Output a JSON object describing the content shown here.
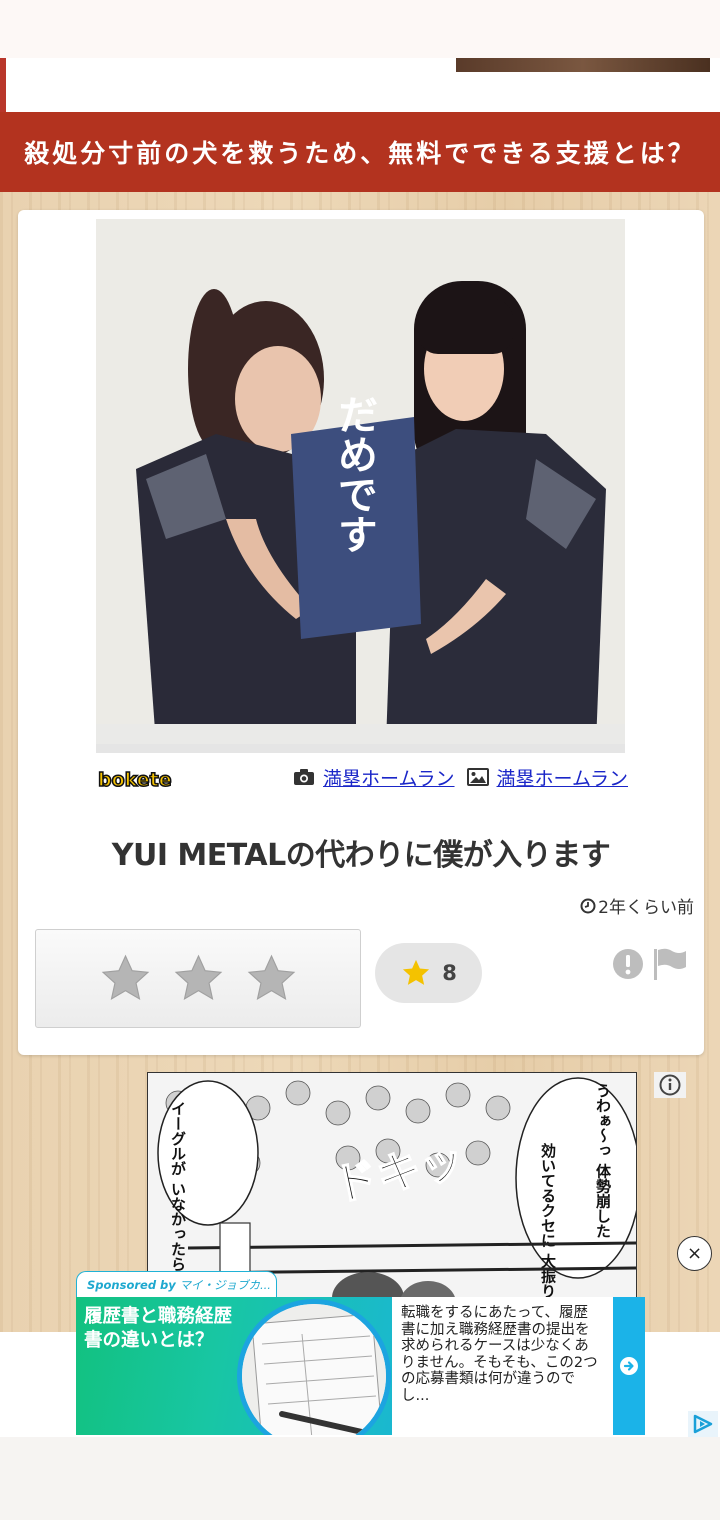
{
  "top_banner": {
    "headline": "殺処分寸前の犬を救うため、無料でできる支援とは？"
  },
  "post": {
    "sign_text": "だめです",
    "logo": "bokete",
    "photo_credit": "満塁ホームラン",
    "image_credit": "満塁ホームラン",
    "caption": "YUI METALの代わりに僕が入ります",
    "timestamp": "2年くらい前",
    "score": "8",
    "rating_stars": 3,
    "icons": {
      "camera": "camera-icon",
      "image": "image-icon",
      "clock": "clock-icon",
      "alert": "alert-icon",
      "flag": "flag-icon",
      "star": "star-icon"
    }
  },
  "ad": {
    "manga_texts": [
      "イーグルが いなかったら 倒れてたぞおっ",
      "うわぁ〜っ 体勢崩した",
      "効いてるクセに 大振りするからだ",
      "ドキッ"
    ],
    "close_symbol": "×"
  },
  "native_ad": {
    "sponsored_label": "Sponsored by",
    "sponsor_name": "マイ・ジョブカ...",
    "headline": "履歴書と職務経歴書の違いとは？",
    "body": "転職をするにあたって、履歴書に加え職務経歴書の提出を求められるケースは少なくありません。そもそも、この2つの応募書類は何が違うのでし..."
  },
  "colors": {
    "banner_red": "#b3331f",
    "link_blue": "#1a26c8",
    "score_star": "#f4c200",
    "ad_teal": "#18c6a4"
  }
}
